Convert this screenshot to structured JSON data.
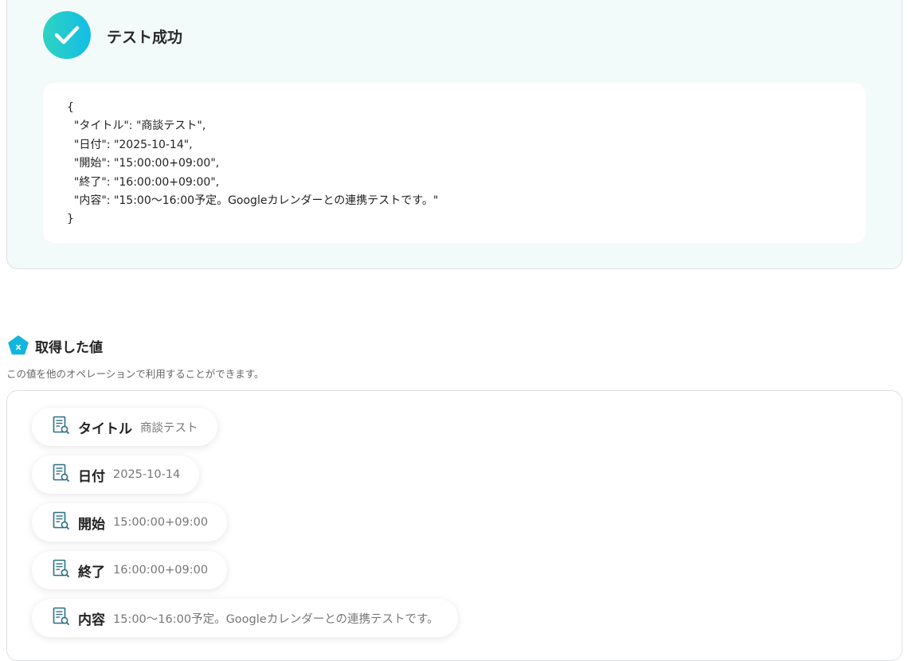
{
  "result": {
    "title": "テスト成功",
    "json_text": "{\n  \"タイトル\": \"商談テスト\",\n  \"日付\": \"2025-10-14\",\n  \"開始\": \"15:00:00+09:00\",\n  \"終了\": \"16:00:00+09:00\",\n  \"内容\": \"15:00〜16:00予定。Googleカレンダーとの連携テストです。\"\n}"
  },
  "values": {
    "title": "取得した値",
    "description": "この値を他のオペレーションで利用することができます。",
    "items": [
      {
        "key": "タイトル",
        "value": "商談テスト"
      },
      {
        "key": "日付",
        "value": "2025-10-14"
      },
      {
        "key": "開始",
        "value": "15:00:00+09:00"
      },
      {
        "key": "終了",
        "value": "16:00:00+09:00"
      },
      {
        "key": "内容",
        "value": "15:00〜16:00予定。Googleカレンダーとの連携テストです。"
      }
    ]
  },
  "colors": {
    "accent": "#12bde6",
    "icon": "#2a6f86"
  }
}
